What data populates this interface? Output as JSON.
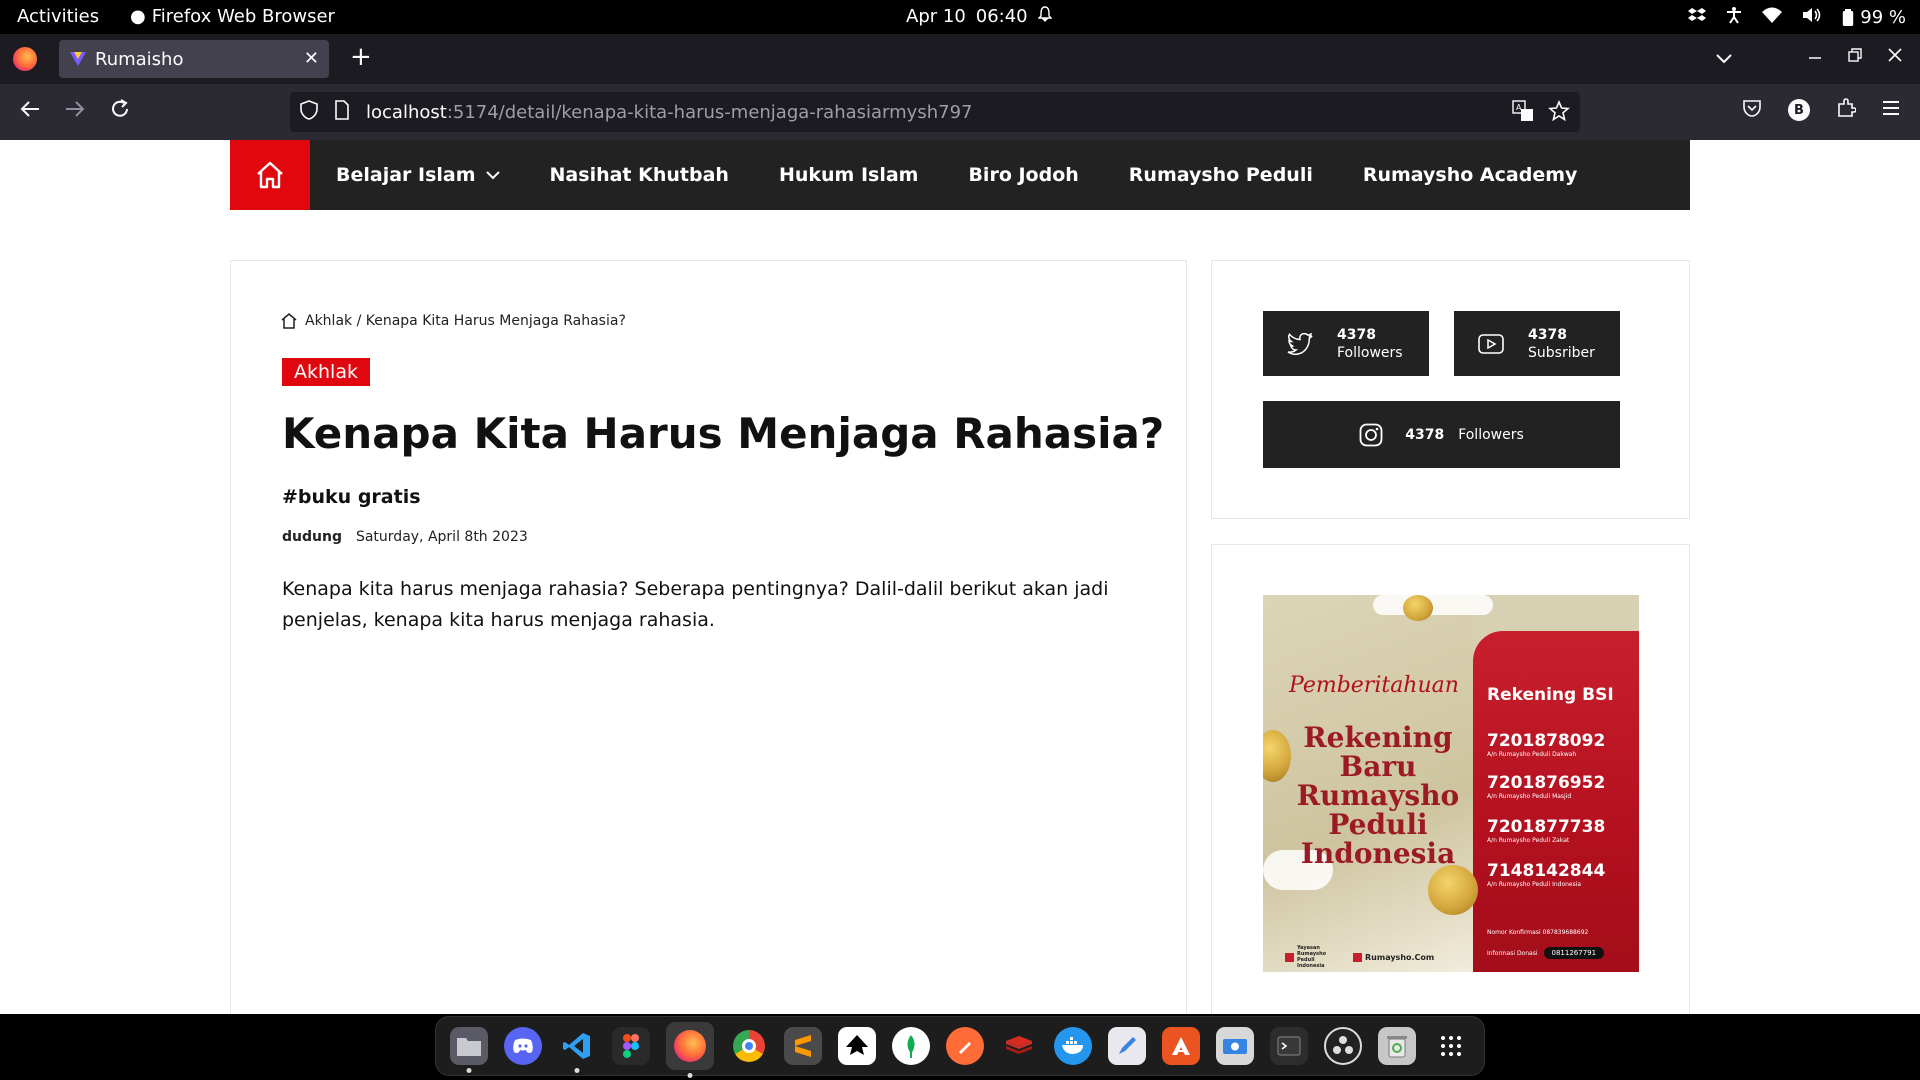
{
  "system_bar": {
    "activities": "Activities",
    "app_name": "Firefox Web Browser",
    "date": "Apr 10",
    "time": "06:40",
    "battery": "99 %"
  },
  "browser": {
    "tab_title": "Rumaisho",
    "url_host": "localhost",
    "url_rest": ":5174/detail/kenapa-kita-harus-menjaga-rahasiarmysh797",
    "profile_initial": "B"
  },
  "site_nav": {
    "items": [
      {
        "label": "Belajar Islam",
        "has_dropdown": true
      },
      {
        "label": "Nasihat Khutbah"
      },
      {
        "label": "Hukum Islam"
      },
      {
        "label": "Biro Jodoh"
      },
      {
        "label": "Rumaysho Peduli"
      },
      {
        "label": "Rumaysho Academy"
      }
    ],
    "accent": "#e0080e",
    "bg": "#222222"
  },
  "article": {
    "breadcrumb": "Akhlak / Kenapa Kita Harus Menjaga Rahasia?",
    "category": "Akhlak",
    "title": "Kenapa Kita Harus Menjaga Rahasia?",
    "tag": "#buku gratis",
    "author": "dudung",
    "date": "Saturday, April 8th 2023",
    "lead": "Kenapa kita harus menjaga rahasia? Seberapa pentingnya? Dalil-dalil berikut akan jadi penjelas, kenapa kita harus menjaga rahasia."
  },
  "social": {
    "twitter": {
      "count": "4378",
      "label": "Followers"
    },
    "youtube": {
      "count": "4378",
      "label": "Subsriber"
    },
    "instagram": {
      "count": "4378",
      "label": "Followers"
    }
  },
  "ad": {
    "script_title": "Pemberitahuan",
    "headline_lines": [
      "Rekening",
      "Baru",
      "Rumaysho",
      "Peduli",
      "Indonesia"
    ],
    "bank_title": "Rekening BSI",
    "accounts": [
      {
        "number": "7201878092",
        "owner": "A/n Rumaysho Peduli Dakwah"
      },
      {
        "number": "7201876952",
        "owner": "A/n Rumaysho Peduli Masjid"
      },
      {
        "number": "7201877738",
        "owner": "A/n Rumaysho Peduli Zakat"
      },
      {
        "number": "7148142844",
        "owner": "A/n Rumaysho Peduli Indonesia"
      }
    ],
    "confirm": "Nomor Konfirmasi 087839688692",
    "info_label": "Informasi Donasi",
    "info_phone": "0811267791",
    "logo_left": "Yayasan Rumaysho Peduli Indonesia",
    "logo_right": "Rumaysho.Com"
  },
  "dock": {
    "apps": [
      "files",
      "discord",
      "vscode",
      "figma",
      "firefox",
      "chrome",
      "sublime-text",
      "inkscape",
      "mongodb-compass",
      "postman",
      "redis",
      "docker",
      "text-editor",
      "app-center",
      "screenshot",
      "terminal",
      "obs",
      "trash",
      "app-grid"
    ]
  }
}
